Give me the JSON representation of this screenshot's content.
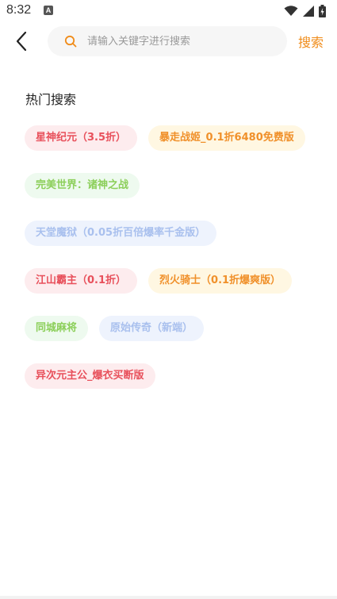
{
  "status_bar": {
    "time": "8:32",
    "notification_icon": "A"
  },
  "search": {
    "placeholder": "请输入关键字进行搜索",
    "value": "",
    "button_label": "搜索"
  },
  "hot_search": {
    "title": "热门搜索",
    "tags": [
      {
        "label": "星神纪元（3.5折）",
        "color": "red"
      },
      {
        "label": "暴走战姬_0.1折6480免费版",
        "color": "orange"
      },
      {
        "label": "完美世界：诸神之战",
        "color": "green"
      },
      {
        "label": "天堂魔狱（0.05折百倍爆率千金版）",
        "color": "blue"
      },
      {
        "label": "江山霸主（0.1折）",
        "color": "red"
      },
      {
        "label": "烈火骑士（0.1折爆爽版）",
        "color": "orange"
      },
      {
        "label": "同城麻将",
        "color": "green"
      },
      {
        "label": "原始传奇（新端）",
        "color": "blue"
      },
      {
        "label": "异次元主公_爆衣买断版",
        "color": "red"
      }
    ]
  },
  "colors": {
    "accent": "#f08c1a",
    "red": "#e8505b",
    "orange": "#f0902a",
    "green": "#8ccf5a",
    "blue": "#a9c0ee"
  },
  "icons": {
    "back": "chevron-left-icon",
    "search": "search-icon",
    "wifi": "wifi-icon",
    "signal": "signal-icon",
    "battery": "battery-icon"
  }
}
